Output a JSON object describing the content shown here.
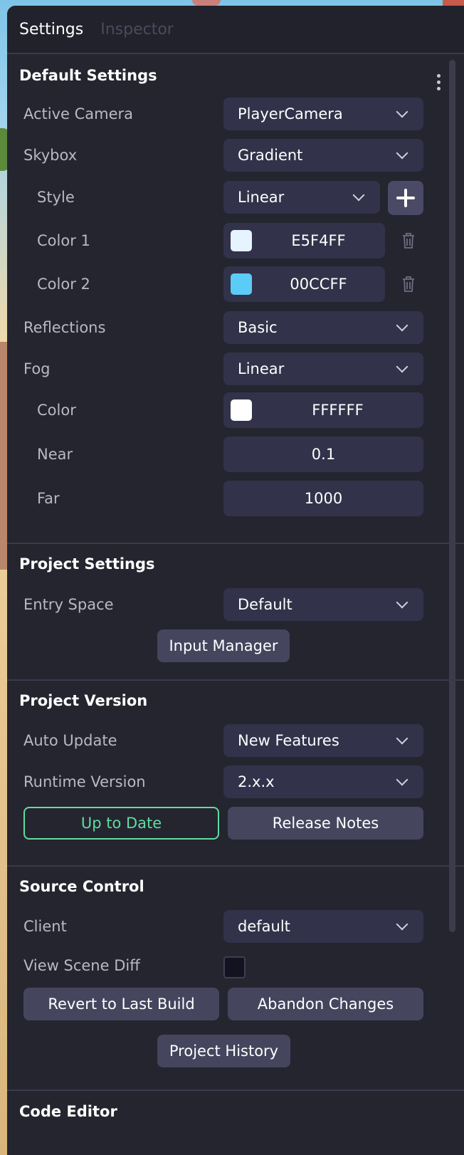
{
  "tabs": [
    {
      "label": "Settings",
      "active": true
    },
    {
      "label": "Inspector",
      "active": false
    }
  ],
  "default_settings": {
    "title": "Default Settings",
    "active_camera": {
      "label": "Active Camera",
      "value": "PlayerCamera"
    },
    "skybox": {
      "label": "Skybox",
      "value": "Gradient"
    },
    "style": {
      "label": "Style",
      "value": "Linear"
    },
    "color1": {
      "label": "Color 1",
      "value": "E5F4FF",
      "swatch": "#E5F4FF"
    },
    "color2": {
      "label": "Color 2",
      "value": "00CCFF",
      "swatch": "#5BCBF8"
    },
    "reflections": {
      "label": "Reflections",
      "value": "Basic"
    },
    "fog": {
      "label": "Fog",
      "value": "Linear"
    },
    "fog_color": {
      "label": "Color",
      "value": "FFFFFF",
      "swatch": "#FFFFFF"
    },
    "near": {
      "label": "Near",
      "value": "0.1"
    },
    "far": {
      "label": "Far",
      "value": "1000"
    }
  },
  "project_settings": {
    "title": "Project Settings",
    "entry_space": {
      "label": "Entry Space",
      "value": "Default"
    },
    "input_manager_label": "Input Manager"
  },
  "project_version": {
    "title": "Project Version",
    "auto_update": {
      "label": "Auto Update",
      "value": "New Features"
    },
    "runtime_version": {
      "label": "Runtime Version",
      "value": "2.x.x"
    },
    "status_label": "Up to Date",
    "release_notes_label": "Release Notes"
  },
  "source_control": {
    "title": "Source Control",
    "client": {
      "label": "Client",
      "value": "default"
    },
    "view_scene_diff": {
      "label": "View Scene Diff",
      "checked": false
    },
    "revert_label": "Revert to Last Build",
    "abandon_label": "Abandon Changes",
    "history_label": "Project History"
  },
  "code_editor": {
    "title": "Code Editor"
  },
  "colors": {
    "accent_green": "#5FDCA0",
    "panel_bg": "#25252F",
    "field_bg": "#32324A"
  }
}
